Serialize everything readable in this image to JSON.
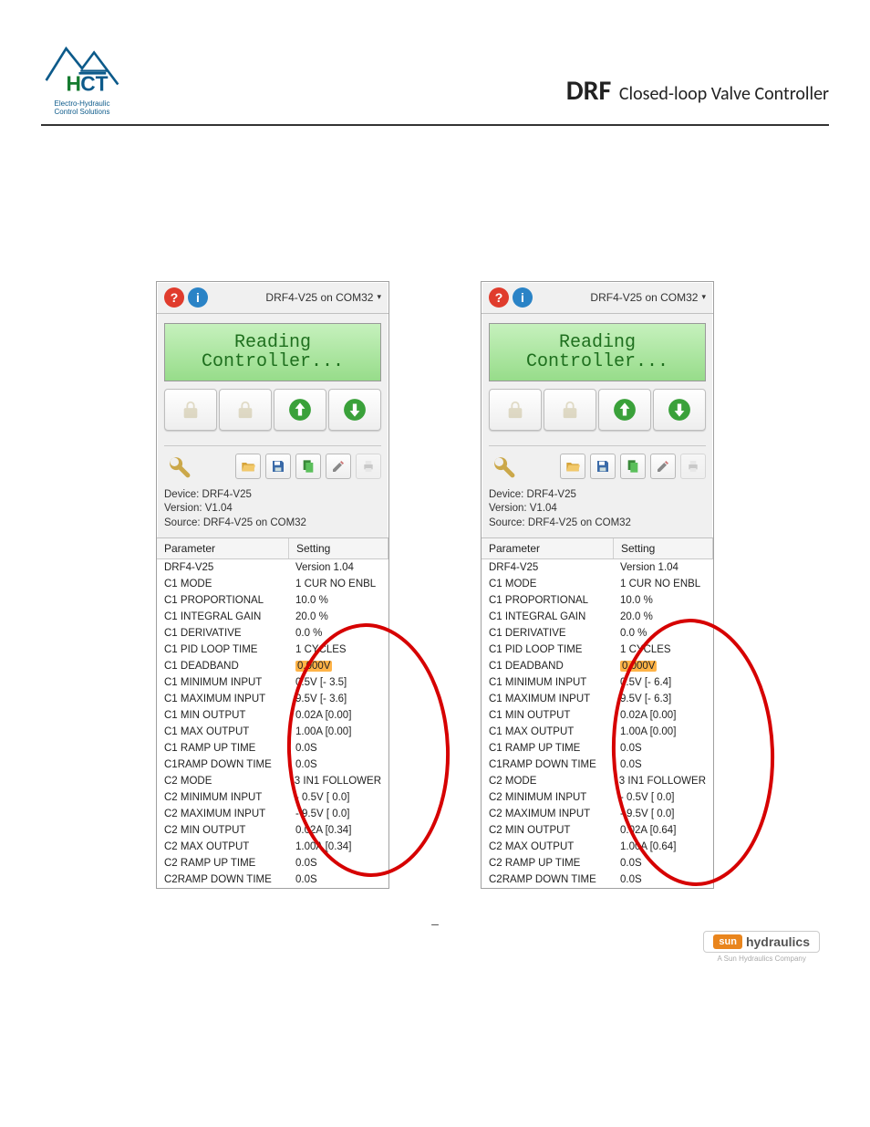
{
  "header": {
    "logo_caption_line1": "Electro-Hydraulic",
    "logo_caption_line2": "Control Solutions",
    "title_big": "DRF",
    "title_rest": "Closed-loop Valve Controller"
  },
  "panel_left": {
    "top_text": "DRF4-V25 on COM32",
    "status_line1": "Reading",
    "status_line2": "Controller...",
    "device": "Device: DRF4-V25",
    "version": "Version: V1.04",
    "source": "Source: DRF4-V25 on COM32",
    "col_param": "Parameter",
    "col_setting": "Setting",
    "rows": [
      {
        "p": "DRF4-V25",
        "s": "Version 1.04"
      },
      {
        "p": "C1 MODE",
        "s": "1 CUR NO ENBL"
      },
      {
        "p": "C1 PROPORTIONAL",
        "s": "10.0 %"
      },
      {
        "p": "C1 INTEGRAL GAIN",
        "s": "20.0 %"
      },
      {
        "p": "C1 DERIVATIVE",
        "s": "0.0 %"
      },
      {
        "p": "C1 PID LOOP TIME",
        "s": "1 CYCLES"
      },
      {
        "p": "C1 DEADBAND",
        "s": "0.000V",
        "hl": true
      },
      {
        "p": "C1 MINIMUM INPUT",
        "s": "0.5V [- 3.5]"
      },
      {
        "p": "C1 MAXIMUM INPUT",
        "s": "9.5V [- 3.6]"
      },
      {
        "p": "C1 MIN OUTPUT",
        "s": "0.02A [0.00]"
      },
      {
        "p": "C1 MAX OUTPUT",
        "s": "1.00A [0.00]"
      },
      {
        "p": "C1 RAMP UP TIME",
        "s": "0.0S"
      },
      {
        "p": "C1RAMP DOWN TIME",
        "s": "0.0S"
      },
      {
        "p": "C2 MODE",
        "s": "3 IN1 FOLLOWER"
      },
      {
        "p": "C2 MINIMUM INPUT",
        "s": "- 0.5V [  0.0]"
      },
      {
        "p": "C2 MAXIMUM INPUT",
        "s": "- 9.5V [  0.0]"
      },
      {
        "p": "C2 MIN OUTPUT",
        "s": "0.02A [0.34]"
      },
      {
        "p": "C2 MAX OUTPUT",
        "s": "1.00A [0.34]"
      },
      {
        "p": "C2 RAMP UP TIME",
        "s": "0.0S"
      },
      {
        "p": "C2RAMP DOWN TIME",
        "s": "0.0S"
      }
    ]
  },
  "panel_right": {
    "top_text": "DRF4-V25 on COM32",
    "status_line1": "Reading",
    "status_line2": "Controller...",
    "device": "Device: DRF4-V25",
    "version": "Version: V1.04",
    "source": "Source: DRF4-V25 on COM32",
    "col_param": "Parameter",
    "col_setting": "Setting",
    "rows": [
      {
        "p": "DRF4-V25",
        "s": "Version 1.04"
      },
      {
        "p": "C1 MODE",
        "s": "1 CUR NO ENBL"
      },
      {
        "p": "C1 PROPORTIONAL",
        "s": "10.0 %"
      },
      {
        "p": "C1 INTEGRAL GAIN",
        "s": "20.0 %"
      },
      {
        "p": "C1 DERIVATIVE",
        "s": "0.0 %"
      },
      {
        "p": "C1 PID LOOP TIME",
        "s": "1 CYCLES"
      },
      {
        "p": "C1 DEADBAND",
        "s": "0.000V",
        "hl": true
      },
      {
        "p": "C1 MINIMUM INPUT",
        "s": "0.5V [- 6.4]"
      },
      {
        "p": "C1 MAXIMUM INPUT",
        "s": "9.5V [- 6.3]"
      },
      {
        "p": "C1 MIN OUTPUT",
        "s": "0.02A [0.00]"
      },
      {
        "p": "C1 MAX OUTPUT",
        "s": "1.00A [0.00]"
      },
      {
        "p": "C1 RAMP UP TIME",
        "s": "0.0S"
      },
      {
        "p": "C1RAMP DOWN TIME",
        "s": "0.0S"
      },
      {
        "p": "C2 MODE",
        "s": "3 IN1 FOLLOWER"
      },
      {
        "p": "C2 MINIMUM INPUT",
        "s": "- 0.5V [  0.0]"
      },
      {
        "p": "C2 MAXIMUM INPUT",
        "s": "- 9.5V [  0.0]"
      },
      {
        "p": "C2 MIN OUTPUT",
        "s": "0.02A [0.64]"
      },
      {
        "p": "C2 MAX OUTPUT",
        "s": "1.00A [0.64]"
      },
      {
        "p": "C2 RAMP UP TIME",
        "s": "0.0S"
      },
      {
        "p": "C2RAMP DOWN TIME",
        "s": "0.0S"
      }
    ]
  },
  "footer": {
    "brand_prefix": "sun",
    "brand": "hydraulics",
    "tagline": "A Sun Hydraulics Company"
  }
}
